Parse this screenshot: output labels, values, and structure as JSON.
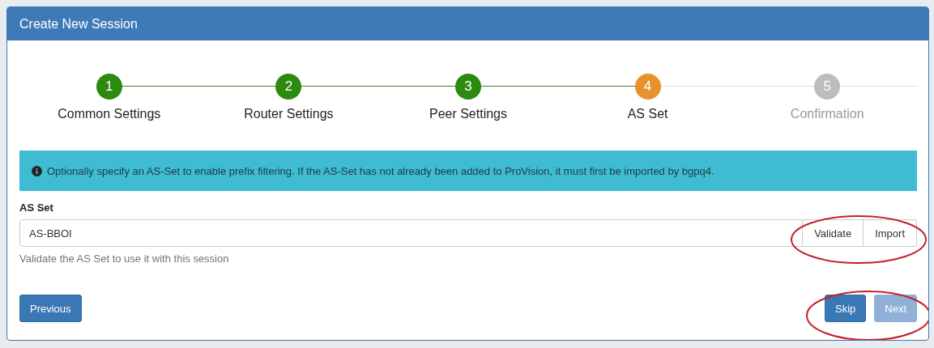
{
  "panel": {
    "title": "Create New Session"
  },
  "steps": [
    {
      "number": "1",
      "label": "Common Settings",
      "completed": true,
      "selected": false
    },
    {
      "number": "2",
      "label": "Router Settings",
      "completed": true,
      "selected": false
    },
    {
      "number": "3",
      "label": "Peer Settings",
      "completed": true,
      "selected": false
    },
    {
      "number": "4",
      "label": "AS Set",
      "completed": false,
      "selected": true
    },
    {
      "number": "5",
      "label": "Confirmation",
      "completed": false,
      "selected": false
    }
  ],
  "alert": {
    "text": "Optionally specify an AS-Set to enable prefix filtering. If the AS-Set has not already been added to ProVision, it must first be imported by bgpq4."
  },
  "field": {
    "label": "AS Set",
    "value": "AS-BBOI",
    "help": "Validate the AS Set to use it with this session",
    "addons": [
      "Validate",
      "Import"
    ]
  },
  "left_buttons": [
    {
      "label": "Previous",
      "disabled": false
    }
  ],
  "right_buttons": [
    {
      "label": "Skip",
      "disabled": false
    },
    {
      "label": "Next",
      "disabled": true
    }
  ]
}
